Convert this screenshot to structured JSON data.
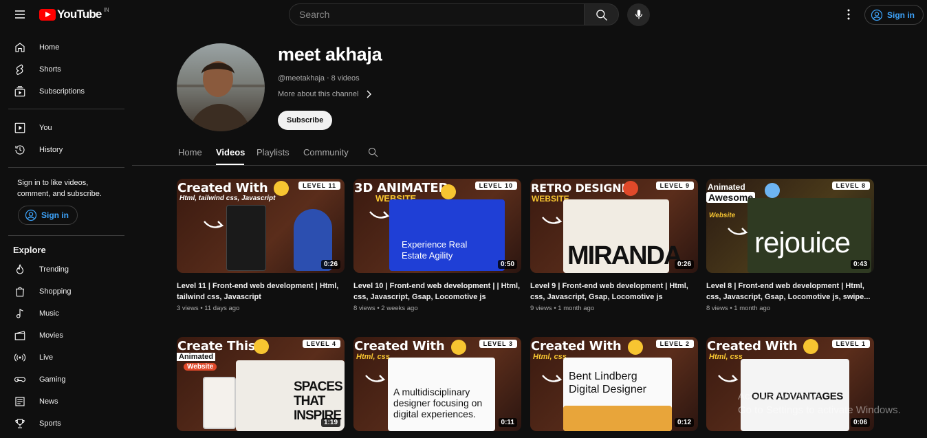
{
  "search": {
    "placeholder": "Search"
  },
  "header": {
    "region": "IN",
    "logo_text": "YouTube",
    "signin_label": "Sign in"
  },
  "sidebar": {
    "items": [
      {
        "label": "Home",
        "icon": "home-icon"
      },
      {
        "label": "Shorts",
        "icon": "shorts-icon"
      },
      {
        "label": "Subscriptions",
        "icon": "subscriptions-icon"
      },
      {
        "label": "You",
        "icon": "you-icon"
      },
      {
        "label": "History",
        "icon": "history-icon"
      }
    ],
    "signin_note": "Sign in to like videos, comment, and subscribe.",
    "signin_label": "Sign in",
    "explore_heading": "Explore",
    "explore": [
      {
        "label": "Trending",
        "icon": "trending-icon"
      },
      {
        "label": "Shopping",
        "icon": "shopping-icon"
      },
      {
        "label": "Music",
        "icon": "music-icon"
      },
      {
        "label": "Movies",
        "icon": "movies-icon"
      },
      {
        "label": "Live",
        "icon": "live-icon"
      },
      {
        "label": "Gaming",
        "icon": "gaming-icon"
      },
      {
        "label": "News",
        "icon": "news-icon"
      },
      {
        "label": "Sports",
        "icon": "sports-icon"
      }
    ]
  },
  "channel": {
    "name": "meet akhaja",
    "meta": "@meetakhaja ‧ 8 videos",
    "about": "More about this channel",
    "subscribe_label": "Subscribe"
  },
  "tabs": [
    "Home",
    "Videos",
    "Playlists",
    "Community"
  ],
  "videos": [
    {
      "title": "Level 11 | Front-end web development | Html, tailwind css, Javascript",
      "meta": "3 views • 11 days ago",
      "duration": "0:26",
      "art_title": "Created With",
      "art_sub": "Html, tailwind css, Javascript",
      "level": "LEVEL 11"
    },
    {
      "title": "Level 10 | Front-end web development | | Html, css, Javascript, Gsap, Locomotive js",
      "meta": "8 views • 2 weeks ago",
      "duration": "0:50",
      "art_title": "3D ANIMATED",
      "art_sub": "WEBSITE",
      "level": "LEVEL 10",
      "art_big": "Experience Real Estate Agility"
    },
    {
      "title": "Level 9 | Front-end web development | Html, css, Javascript, Gsap, Locomotive js",
      "meta": "9 views • 1 month ago",
      "duration": "0:26",
      "art_title": "RETRO DESIGNE",
      "art_sub": "WEBSITE",
      "level": "LEVEL 9",
      "art_big": "MIRANDA"
    },
    {
      "title": "Level 8 | Front-end web development | Html, css, Javascript, Gsap, Locomotive js, swipe...",
      "meta": "8 views • 1 month ago",
      "duration": "0:43",
      "art_title": "Animated",
      "art_sub": "Website",
      "level": "LEVEL 8",
      "art_big": "rejouice",
      "art_title2": "Awesome"
    },
    {
      "title": "",
      "meta": "",
      "duration": "1:19",
      "art_title": "Create This",
      "art_sub": "Animated",
      "art_sub2": "Website",
      "level": "LEVEL 4",
      "art_big": "SPACES THAT INSPIRE"
    },
    {
      "title": "",
      "meta": "",
      "duration": "0:11",
      "art_title": "Created With",
      "art_sub": "Html, css",
      "level": "LEVEL 3",
      "art_big": "A multidisciplinary designer focusing on digital experiences."
    },
    {
      "title": "",
      "meta": "",
      "duration": "0:12",
      "art_title": "Created With",
      "art_sub": "Html, css",
      "level": "LEVEL 2",
      "art_big": "Bent Lindberg Digital Designer"
    },
    {
      "title": "",
      "meta": "",
      "duration": "0:06",
      "art_title": "Created With",
      "art_sub": "Html, css",
      "level": "LEVEL 1",
      "art_big": "OUR ADVANTAGES"
    }
  ],
  "watermark": {
    "line1": "Activate Windows",
    "line2": "Go to Settings to activate Windows."
  }
}
